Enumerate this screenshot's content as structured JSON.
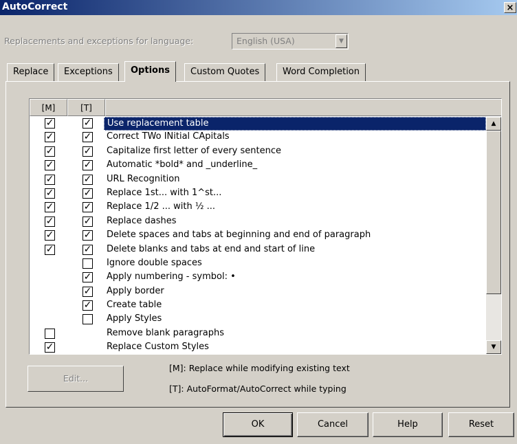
{
  "window": {
    "title": "AutoCorrect",
    "close_label": "×"
  },
  "language": {
    "label": "Replacements and exceptions for language:",
    "value": "English (USA)"
  },
  "tabs": [
    {
      "label": "Replace"
    },
    {
      "label": "Exceptions"
    },
    {
      "label": "Options"
    },
    {
      "label": "Custom Quotes"
    },
    {
      "label": "Word Completion"
    }
  ],
  "list": {
    "header_m": "[M]",
    "header_t": "[T]",
    "rows": [
      {
        "label": "Use replacement table",
        "m": "✓",
        "t": "✓"
      },
      {
        "label": "Correct TWo INitial CApitals",
        "m": "✓",
        "t": "✓"
      },
      {
        "label": "Capitalize first letter of every sentence",
        "m": "✓",
        "t": "✓"
      },
      {
        "label": "Automatic *bold* and _underline_",
        "m": "✓",
        "t": "✓"
      },
      {
        "label": "URL Recognition",
        "m": "✓",
        "t": "✓"
      },
      {
        "label": "Replace 1st... with 1^st...",
        "m": "✓",
        "t": "✓"
      },
      {
        "label": "Replace 1/2 ... with ½ ...",
        "m": "✓",
        "t": "✓"
      },
      {
        "label": "Replace dashes",
        "m": "✓",
        "t": "✓"
      },
      {
        "label": "Delete spaces and tabs at beginning and end of paragraph",
        "m": "✓",
        "t": "✓"
      },
      {
        "label": "Delete blanks and tabs at end and start of line",
        "m": "✓",
        "t": "✓"
      },
      {
        "label": "Ignore double spaces",
        "m": null,
        "t": ""
      },
      {
        "label": "Apply numbering - symbol: •",
        "m": null,
        "t": "✓"
      },
      {
        "label": "Apply border",
        "m": null,
        "t": "✓"
      },
      {
        "label": "Create table",
        "m": null,
        "t": "✓"
      },
      {
        "label": "Apply Styles",
        "m": null,
        "t": ""
      },
      {
        "label": "Remove blank paragraphs",
        "m": "",
        "t": null
      },
      {
        "label": "Replace Custom Styles",
        "m": "✓",
        "t": null
      }
    ]
  },
  "edit_button": "Edit...",
  "legend": {
    "m": "[M]: Replace while modifying existing text",
    "t": "[T]: AutoFormat/AutoCorrect while typing"
  },
  "buttons": {
    "ok": "OK",
    "cancel": "Cancel",
    "help": "Help",
    "reset": "Reset"
  },
  "colors": {
    "selection": "#0a246a",
    "face": "#d4d0c8"
  }
}
